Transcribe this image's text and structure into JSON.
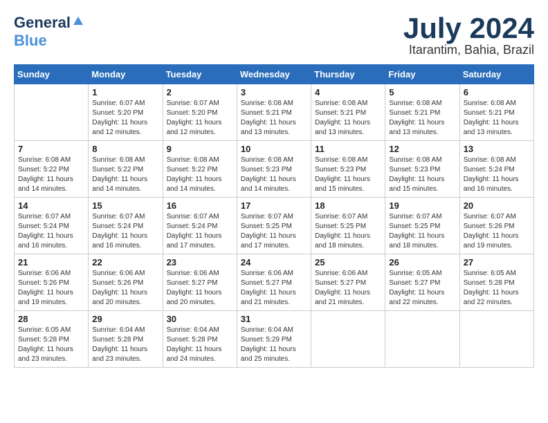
{
  "header": {
    "logo_line1": "General",
    "logo_line2": "Blue",
    "month": "July 2024",
    "location": "Itarantim, Bahia, Brazil"
  },
  "weekdays": [
    "Sunday",
    "Monday",
    "Tuesday",
    "Wednesday",
    "Thursday",
    "Friday",
    "Saturday"
  ],
  "weeks": [
    [
      {
        "day": "",
        "sunrise": "",
        "sunset": "",
        "daylight": ""
      },
      {
        "day": "1",
        "sunrise": "Sunrise: 6:07 AM",
        "sunset": "Sunset: 5:20 PM",
        "daylight": "Daylight: 11 hours and 12 minutes."
      },
      {
        "day": "2",
        "sunrise": "Sunrise: 6:07 AM",
        "sunset": "Sunset: 5:20 PM",
        "daylight": "Daylight: 11 hours and 12 minutes."
      },
      {
        "day": "3",
        "sunrise": "Sunrise: 6:08 AM",
        "sunset": "Sunset: 5:21 PM",
        "daylight": "Daylight: 11 hours and 13 minutes."
      },
      {
        "day": "4",
        "sunrise": "Sunrise: 6:08 AM",
        "sunset": "Sunset: 5:21 PM",
        "daylight": "Daylight: 11 hours and 13 minutes."
      },
      {
        "day": "5",
        "sunrise": "Sunrise: 6:08 AM",
        "sunset": "Sunset: 5:21 PM",
        "daylight": "Daylight: 11 hours and 13 minutes."
      },
      {
        "day": "6",
        "sunrise": "Sunrise: 6:08 AM",
        "sunset": "Sunset: 5:21 PM",
        "daylight": "Daylight: 11 hours and 13 minutes."
      }
    ],
    [
      {
        "day": "7",
        "sunrise": "Sunrise: 6:08 AM",
        "sunset": "Sunset: 5:22 PM",
        "daylight": "Daylight: 11 hours and 14 minutes."
      },
      {
        "day": "8",
        "sunrise": "Sunrise: 6:08 AM",
        "sunset": "Sunset: 5:22 PM",
        "daylight": "Daylight: 11 hours and 14 minutes."
      },
      {
        "day": "9",
        "sunrise": "Sunrise: 6:08 AM",
        "sunset": "Sunset: 5:22 PM",
        "daylight": "Daylight: 11 hours and 14 minutes."
      },
      {
        "day": "10",
        "sunrise": "Sunrise: 6:08 AM",
        "sunset": "Sunset: 5:23 PM",
        "daylight": "Daylight: 11 hours and 14 minutes."
      },
      {
        "day": "11",
        "sunrise": "Sunrise: 6:08 AM",
        "sunset": "Sunset: 5:23 PM",
        "daylight": "Daylight: 11 hours and 15 minutes."
      },
      {
        "day": "12",
        "sunrise": "Sunrise: 6:08 AM",
        "sunset": "Sunset: 5:23 PM",
        "daylight": "Daylight: 11 hours and 15 minutes."
      },
      {
        "day": "13",
        "sunrise": "Sunrise: 6:08 AM",
        "sunset": "Sunset: 5:24 PM",
        "daylight": "Daylight: 11 hours and 16 minutes."
      }
    ],
    [
      {
        "day": "14",
        "sunrise": "Sunrise: 6:07 AM",
        "sunset": "Sunset: 5:24 PM",
        "daylight": "Daylight: 11 hours and 16 minutes."
      },
      {
        "day": "15",
        "sunrise": "Sunrise: 6:07 AM",
        "sunset": "Sunset: 5:24 PM",
        "daylight": "Daylight: 11 hours and 16 minutes."
      },
      {
        "day": "16",
        "sunrise": "Sunrise: 6:07 AM",
        "sunset": "Sunset: 5:24 PM",
        "daylight": "Daylight: 11 hours and 17 minutes."
      },
      {
        "day": "17",
        "sunrise": "Sunrise: 6:07 AM",
        "sunset": "Sunset: 5:25 PM",
        "daylight": "Daylight: 11 hours and 17 minutes."
      },
      {
        "day": "18",
        "sunrise": "Sunrise: 6:07 AM",
        "sunset": "Sunset: 5:25 PM",
        "daylight": "Daylight: 11 hours and 18 minutes."
      },
      {
        "day": "19",
        "sunrise": "Sunrise: 6:07 AM",
        "sunset": "Sunset: 5:25 PM",
        "daylight": "Daylight: 11 hours and 18 minutes."
      },
      {
        "day": "20",
        "sunrise": "Sunrise: 6:07 AM",
        "sunset": "Sunset: 5:26 PM",
        "daylight": "Daylight: 11 hours and 19 minutes."
      }
    ],
    [
      {
        "day": "21",
        "sunrise": "Sunrise: 6:06 AM",
        "sunset": "Sunset: 5:26 PM",
        "daylight": "Daylight: 11 hours and 19 minutes."
      },
      {
        "day": "22",
        "sunrise": "Sunrise: 6:06 AM",
        "sunset": "Sunset: 5:26 PM",
        "daylight": "Daylight: 11 hours and 20 minutes."
      },
      {
        "day": "23",
        "sunrise": "Sunrise: 6:06 AM",
        "sunset": "Sunset: 5:27 PM",
        "daylight": "Daylight: 11 hours and 20 minutes."
      },
      {
        "day": "24",
        "sunrise": "Sunrise: 6:06 AM",
        "sunset": "Sunset: 5:27 PM",
        "daylight": "Daylight: 11 hours and 21 minutes."
      },
      {
        "day": "25",
        "sunrise": "Sunrise: 6:06 AM",
        "sunset": "Sunset: 5:27 PM",
        "daylight": "Daylight: 11 hours and 21 minutes."
      },
      {
        "day": "26",
        "sunrise": "Sunrise: 6:05 AM",
        "sunset": "Sunset: 5:27 PM",
        "daylight": "Daylight: 11 hours and 22 minutes."
      },
      {
        "day": "27",
        "sunrise": "Sunrise: 6:05 AM",
        "sunset": "Sunset: 5:28 PM",
        "daylight": "Daylight: 11 hours and 22 minutes."
      }
    ],
    [
      {
        "day": "28",
        "sunrise": "Sunrise: 6:05 AM",
        "sunset": "Sunset: 5:28 PM",
        "daylight": "Daylight: 11 hours and 23 minutes."
      },
      {
        "day": "29",
        "sunrise": "Sunrise: 6:04 AM",
        "sunset": "Sunset: 5:28 PM",
        "daylight": "Daylight: 11 hours and 23 minutes."
      },
      {
        "day": "30",
        "sunrise": "Sunrise: 6:04 AM",
        "sunset": "Sunset: 5:28 PM",
        "daylight": "Daylight: 11 hours and 24 minutes."
      },
      {
        "day": "31",
        "sunrise": "Sunrise: 6:04 AM",
        "sunset": "Sunset: 5:29 PM",
        "daylight": "Daylight: 11 hours and 25 minutes."
      },
      {
        "day": "",
        "sunrise": "",
        "sunset": "",
        "daylight": ""
      },
      {
        "day": "",
        "sunrise": "",
        "sunset": "",
        "daylight": ""
      },
      {
        "day": "",
        "sunrise": "",
        "sunset": "",
        "daylight": ""
      }
    ]
  ]
}
